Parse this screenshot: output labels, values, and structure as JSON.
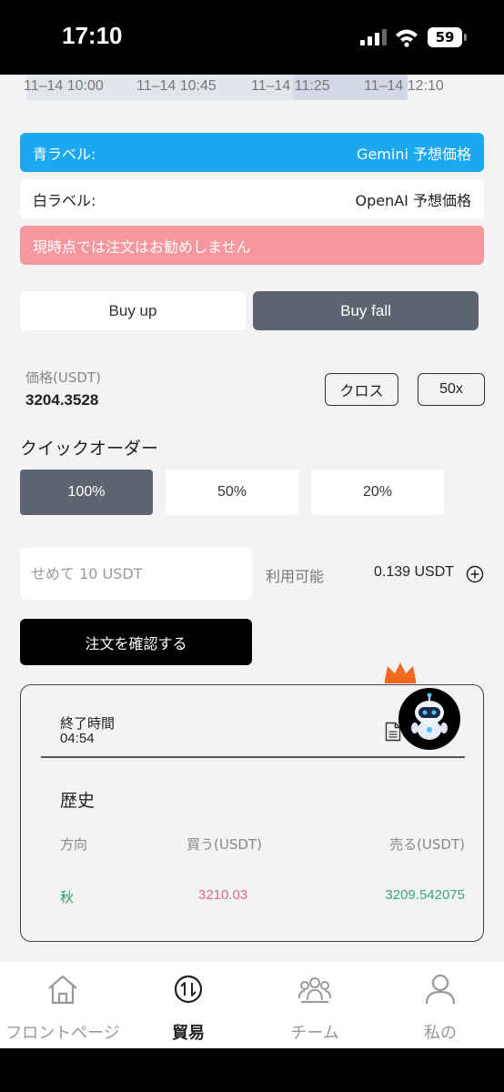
{
  "status_bar": {
    "time": "17:10",
    "battery": "59"
  },
  "chart": {
    "x_ticks": [
      "11–14 10:00",
      "11–14 10:45",
      "11–14 11:25",
      "11–14 12:10"
    ]
  },
  "labels": {
    "blue_key": "青ラベル:",
    "blue_value": "Gemini 予想価格",
    "white_key": "白ラベル:",
    "white_value": "OpenAI 予想価格",
    "warning": "現時点では注文はお勧めしません"
  },
  "direction": {
    "buy_up": "Buy up",
    "buy_fall": "Buy fall",
    "selected": "Buy fall"
  },
  "price": {
    "label": "価格(USDT)",
    "value": "3204.3528",
    "margin_mode": "クロス",
    "leverage": "50x"
  },
  "quick_order": {
    "title": "クイックオーダー",
    "options": [
      "100%",
      "50%",
      "20%"
    ],
    "selected": "100%"
  },
  "amount": {
    "placeholder": "せめて 10 USDT",
    "value": ""
  },
  "available": {
    "label": "利用可能",
    "value": "0.139 USDT"
  },
  "confirm_label": "注文を確認する",
  "panel": {
    "end_label": "終了時間",
    "end_time": "04:54",
    "history_title": "歴史",
    "columns": [
      "方向",
      "買う(USDT)",
      "売る(USDT)"
    ],
    "rows": [
      {
        "direction": "秋",
        "buy": "3210.03",
        "sell": "3209.542075"
      }
    ]
  },
  "colors": {
    "accent_blue": "#1ba8f0",
    "warning_pink": "#f5979f",
    "selected_gray": "#5c6470",
    "direction_green": "#2e9e6a",
    "buy_pink": "#d86a8e",
    "sell_green": "#3aa679"
  },
  "tabbar": {
    "tabs": [
      {
        "label": "フロントページ",
        "icon": "home-icon"
      },
      {
        "label": "貿易",
        "icon": "trade-icon"
      },
      {
        "label": "チーム",
        "icon": "team-icon"
      },
      {
        "label": "私の",
        "icon": "user-icon"
      }
    ],
    "active": "貿易"
  }
}
